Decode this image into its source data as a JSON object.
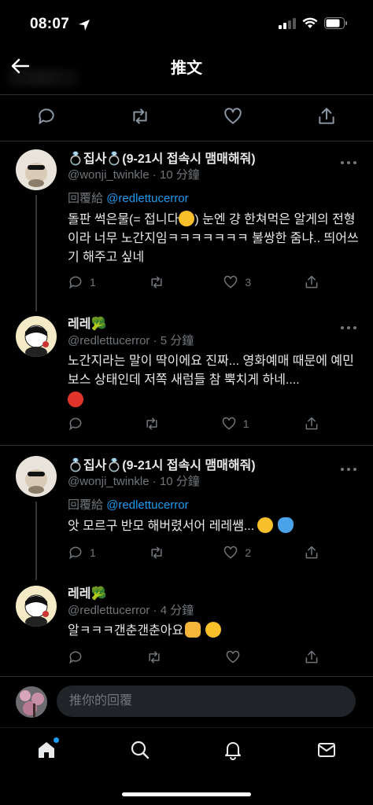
{
  "status_bar": {
    "time": "08:07"
  },
  "header": {
    "title": "推文"
  },
  "tweets": [
    {
      "name": "💍집사💍(9-21시 접속시 맴매해줘)",
      "handle": "@wonji_twinkle",
      "time_ago": "10 分鐘",
      "reply_prefix": "回覆給",
      "reply_to": "@redlettucerror",
      "text_1": "돌판 썩은물(= 접니다",
      "text_2": ") 눈엔 걍 한쳐먹은 알게의 전형이라 너무 노간지임ㅋㅋㅋㅋㅋㅋㅋ 불쌍한 줌냐.. 띄어쓰기 해주고 싶네",
      "replies": "1",
      "retweets": "",
      "likes": "3"
    },
    {
      "name": "레레🥦",
      "handle": "@redlettucerror",
      "time_ago": "5 分鐘",
      "text_1": "노간지라는 말이 딱이에요 진짜... 영화예매 때문에 예민보스 상태인데 저쪽 새럼들 참 뿍치게 하네....",
      "replies": "",
      "retweets": "",
      "likes": "1"
    },
    {
      "name": "💍집사💍(9-21시 접속시 맴매해줘)",
      "handle": "@wonji_twinkle",
      "time_ago": "10 分鐘",
      "reply_prefix": "回覆給",
      "reply_to": "@redlettucerror",
      "text_1": "앗 모르구 반모 해버렸서어 레레쌤...",
      "replies": "1",
      "retweets": "",
      "likes": "2"
    },
    {
      "name": "레레🥦",
      "handle": "@redlettucerror",
      "time_ago": "4 分鐘",
      "text_1": "알ㅋㅋㅋ갠춘갠춘아요",
      "replies": "",
      "retweets": "",
      "likes": ""
    }
  ],
  "compose": {
    "placeholder": "推你的回覆"
  },
  "colors": {
    "accent": "#1d9bf0",
    "muted": "#71767b",
    "background": "#000000"
  }
}
